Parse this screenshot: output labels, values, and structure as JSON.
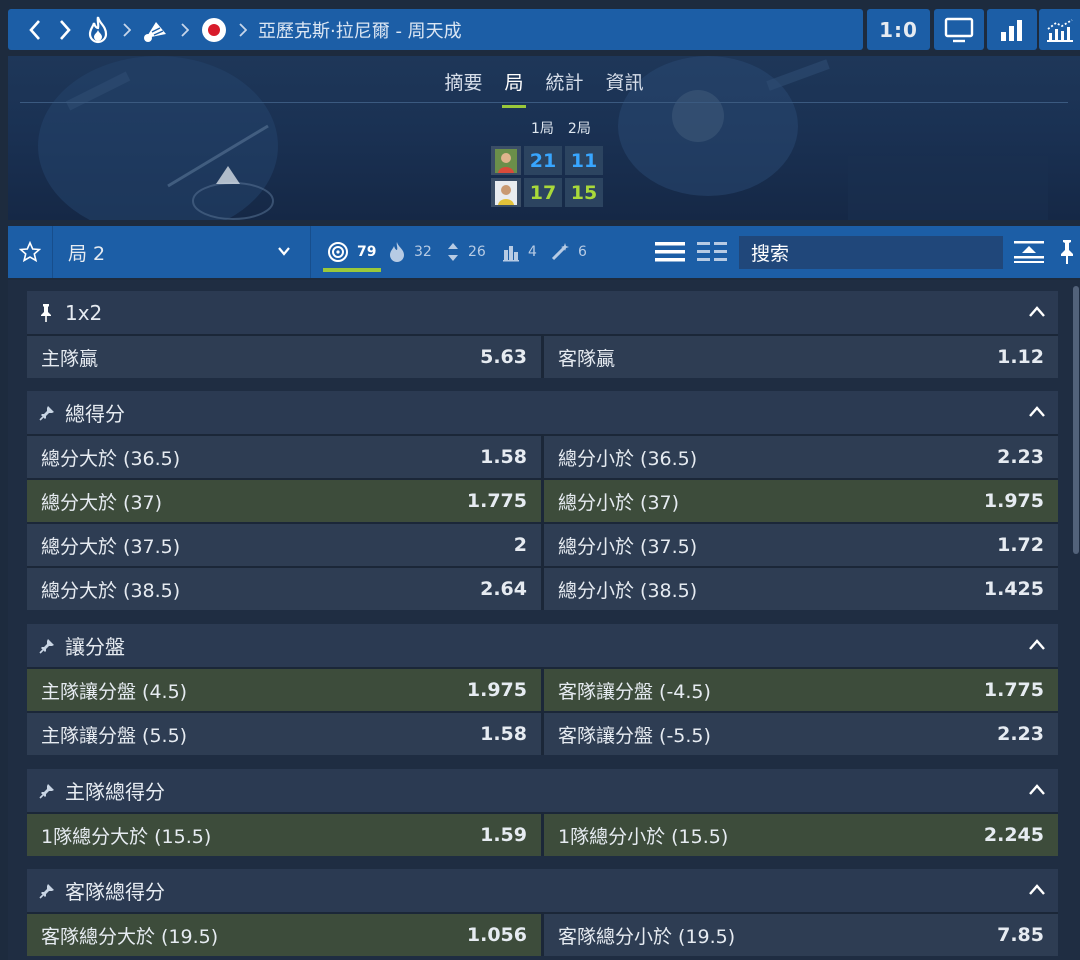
{
  "header": {
    "title": "亞歷克斯·拉尼爾 - 周天成",
    "score": "1:0"
  },
  "tabs": [
    "摘要",
    "局",
    "統計",
    "資訊"
  ],
  "active_tab": "局",
  "scoreboard": {
    "set_labels": [
      "1局",
      "2局"
    ],
    "home_scores": [
      "21",
      "11"
    ],
    "away_scores": [
      "17",
      "15"
    ]
  },
  "filterbar": {
    "set_select": "局 2",
    "counts": [
      "79",
      "32",
      "26",
      "4",
      "6"
    ],
    "search_placeholder": "搜索"
  },
  "markets": [
    {
      "title": "1x2",
      "rows": [
        [
          {
            "label": "主隊贏",
            "odd": "5.63"
          },
          {
            "label": "客隊贏",
            "odd": "1.12"
          }
        ]
      ]
    },
    {
      "title": "總得分",
      "rows": [
        [
          {
            "label": "總分大於 (36.5)",
            "odd": "1.58"
          },
          {
            "label": "總分小於 (36.5)",
            "odd": "2.23"
          }
        ],
        [
          {
            "label": "總分大於 (37)",
            "odd": "1.775"
          },
          {
            "label": "總分小於 (37)",
            "odd": "1.975"
          }
        ],
        [
          {
            "label": "總分大於 (37.5)",
            "odd": "2"
          },
          {
            "label": "總分小於 (37.5)",
            "odd": "1.72"
          }
        ],
        [
          {
            "label": "總分大於 (38.5)",
            "odd": "2.64"
          },
          {
            "label": "總分小於 (38.5)",
            "odd": "1.425"
          }
        ]
      ]
    },
    {
      "title": "讓分盤",
      "rows": [
        [
          {
            "label": "主隊讓分盤 (4.5)",
            "odd": "1.975"
          },
          {
            "label": "客隊讓分盤 (-4.5)",
            "odd": "1.775"
          }
        ],
        [
          {
            "label": "主隊讓分盤 (5.5)",
            "odd": "1.58"
          },
          {
            "label": "客隊讓分盤 (-5.5)",
            "odd": "2.23"
          }
        ]
      ]
    },
    {
      "title": "主隊總得分",
      "rows": [
        [
          {
            "label": "1隊總分大於 (15.5)",
            "odd": "1.59"
          },
          {
            "label": "1隊總分小於 (15.5)",
            "odd": "2.245"
          }
        ]
      ]
    },
    {
      "title": "客隊總得分",
      "rows": [
        [
          {
            "label": "客隊總分大於 (19.5)",
            "odd": "1.056"
          },
          {
            "label": "客隊總分小於 (19.5)",
            "odd": "7.85"
          }
        ]
      ]
    }
  ],
  "colors": {
    "brand_blue": "#1c5ea6",
    "accent_green": "#9ac83a",
    "score_blue": "#38a6ff",
    "score_green": "#a9d93a",
    "highlight_row": "#3d4c3b"
  }
}
